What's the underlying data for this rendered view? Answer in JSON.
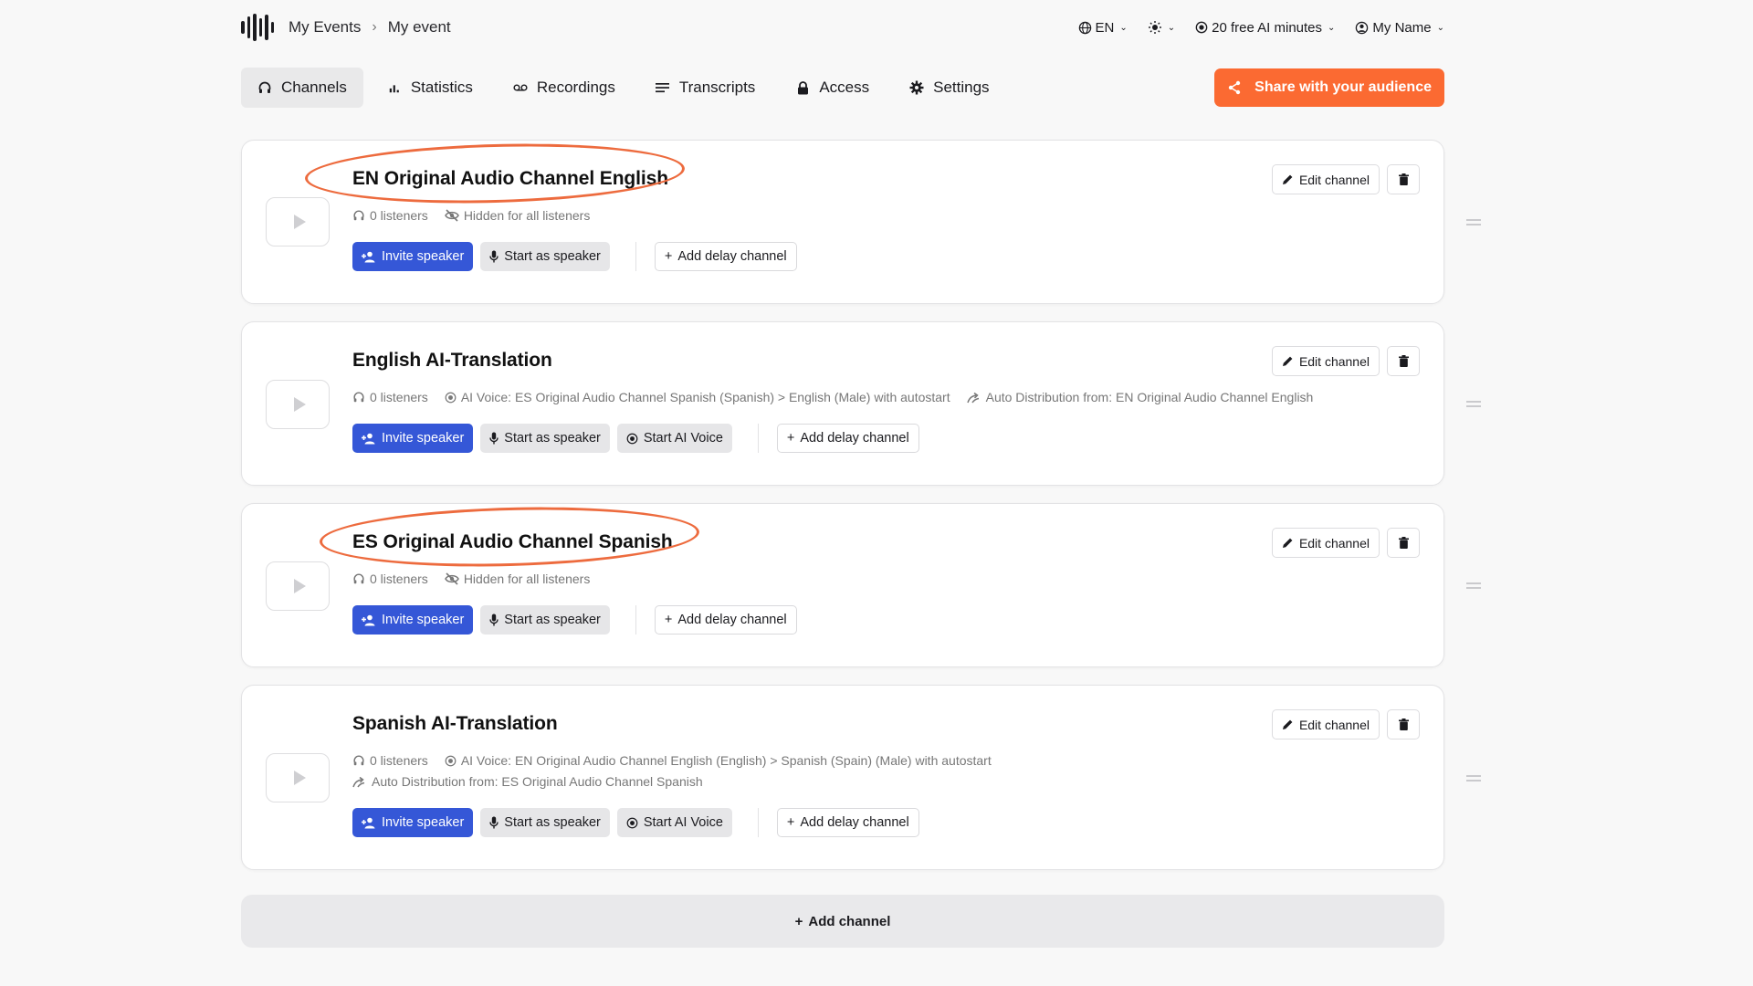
{
  "breadcrumb": {
    "root": "My Events",
    "separator": "›",
    "current": "My event"
  },
  "topbar": {
    "language": "EN",
    "ai_minutes": "20 free AI minutes",
    "user": "My Name"
  },
  "tabs": [
    {
      "label": "Channels",
      "icon": "headphones-icon",
      "active": true
    },
    {
      "label": "Statistics",
      "icon": "bar-chart-icon",
      "active": false
    },
    {
      "label": "Recordings",
      "icon": "recording-icon",
      "active": false
    },
    {
      "label": "Transcripts",
      "icon": "lines-icon",
      "active": false
    },
    {
      "label": "Access",
      "icon": "lock-icon",
      "active": false
    },
    {
      "label": "Settings",
      "icon": "gear-icon",
      "active": false
    }
  ],
  "share_button": "Share with your audience",
  "labels": {
    "invite_speaker": "Invite speaker",
    "start_as_speaker": "Start as speaker",
    "start_ai_voice": "Start AI Voice",
    "add_delay_channel": "Add delay channel",
    "edit_channel": "Edit channel",
    "add_channel": "Add channel"
  },
  "channels": [
    {
      "title": "EN Original Audio Channel English",
      "listeners": "0 listeners",
      "visibility": "Hidden for all listeners",
      "highlighted": true
    },
    {
      "title": "English AI-Translation",
      "listeners": "0 listeners",
      "ai_voice": "AI Voice: ES Original Audio Channel Spanish (Spanish) > English (Male) with autostart",
      "auto_distribution": "Auto Distribution from: EN Original Audio Channel English"
    },
    {
      "title": "ES Original Audio Channel Spanish",
      "listeners": "0 listeners",
      "visibility": "Hidden for all listeners",
      "highlighted": true
    },
    {
      "title": "Spanish AI-Translation",
      "listeners": "0 listeners",
      "ai_voice": "AI Voice: EN Original Audio Channel English (English) > Spanish (Spain) (Male) with autostart",
      "auto_distribution": "Auto Distribution from: ES Original Audio Channel Spanish"
    }
  ],
  "colors": {
    "accent": "#fb6a32",
    "primary": "#3557d7",
    "highlight": "#ed6b3e"
  }
}
